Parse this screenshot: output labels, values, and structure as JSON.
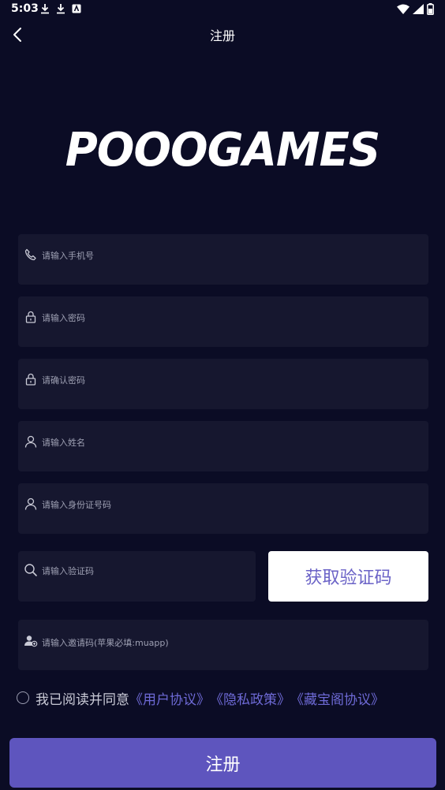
{
  "status_bar": {
    "time": "5:03"
  },
  "header": {
    "title": "注册"
  },
  "brand": {
    "logo_text": "POOOGAMES"
  },
  "form": {
    "phone": {
      "placeholder": "请输入手机号",
      "icon": "phone-icon"
    },
    "password": {
      "placeholder": "请输入密码",
      "icon": "lock-icon"
    },
    "confirm_password": {
      "placeholder": "请确认密码",
      "icon": "lock-icon"
    },
    "name": {
      "placeholder": "请输入姓名",
      "icon": "user-icon"
    },
    "id_number": {
      "placeholder": "请输入身份证号码",
      "icon": "user-icon"
    },
    "verify_code": {
      "placeholder": "请输入验证码",
      "icon": "search-icon"
    },
    "invite_code": {
      "placeholder": "请输入邀请码(苹果必填:muapp)",
      "icon": "add-user-icon"
    },
    "get_code_label": "获取验证码"
  },
  "agreement": {
    "prefix": "我已阅读并同意",
    "links": [
      "《用户协议》",
      "《隐私政策》",
      "《藏宝阁协议》"
    ]
  },
  "submit": {
    "label": "注册"
  },
  "colors": {
    "background": "#0b0c25",
    "field_bg": "#16172f",
    "accent": "#5e55be",
    "link": "#6e6ad6"
  }
}
